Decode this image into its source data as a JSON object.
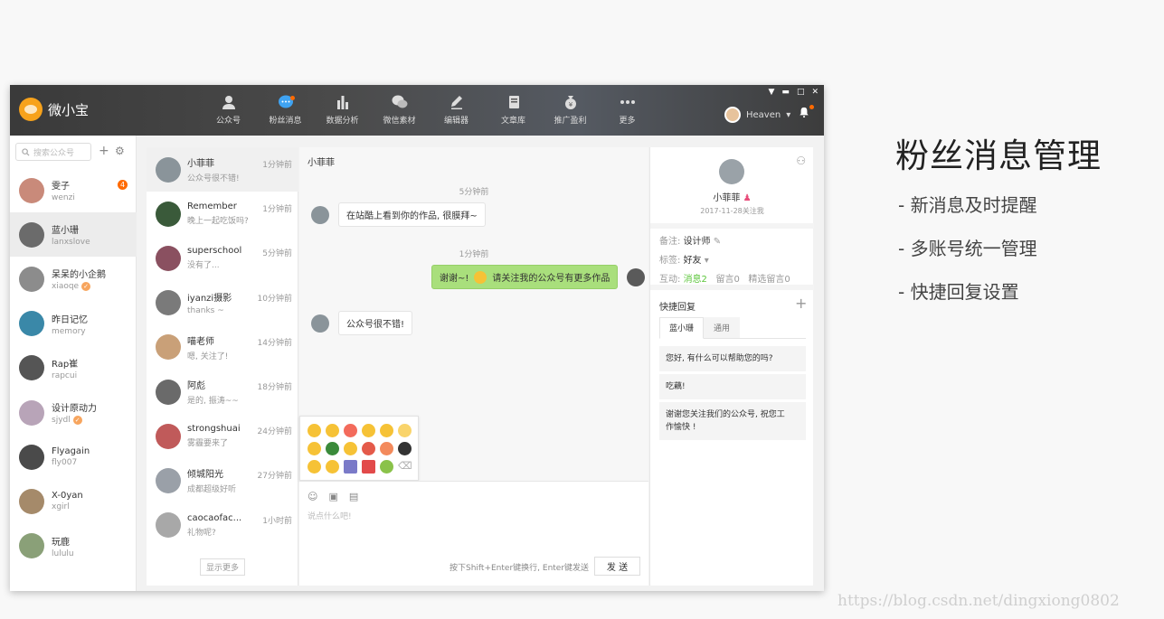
{
  "app": {
    "name": "微小宝"
  },
  "nav": [
    {
      "label": "公众号",
      "icon": "user-icon"
    },
    {
      "label": "粉丝消息",
      "icon": "chat-bubble-icon",
      "dot": true
    },
    {
      "label": "数据分析",
      "icon": "bar-chart-icon"
    },
    {
      "label": "微信素材",
      "icon": "wechat-icon"
    },
    {
      "label": "编辑器",
      "icon": "pen-icon"
    },
    {
      "label": "文章库",
      "icon": "document-icon"
    },
    {
      "label": "推广盈利",
      "icon": "money-bag-icon"
    },
    {
      "label": "更多",
      "icon": "more-dots-icon"
    }
  ],
  "user": {
    "name": "Heaven"
  },
  "sidebar": {
    "search_placeholder": "搜索公众号",
    "accounts": [
      {
        "name": "雯子",
        "sub": "wenzi",
        "count": "4",
        "color": "#c98a7a"
      },
      {
        "name": "蓝小珊",
        "sub": "lanxslove",
        "color": "#6b6b6b"
      },
      {
        "name": "呆呆的小企鹅",
        "sub": "xiaoqe",
        "verified": true,
        "color": "#8c8c8c"
      },
      {
        "name": "昨日记忆",
        "sub": "memory",
        "color": "#3a88a8"
      },
      {
        "name": "Rap崔",
        "sub": "rapcui",
        "color": "#555555"
      },
      {
        "name": "设计原动力",
        "sub": "sjydl",
        "verified": true,
        "color": "#b8a4b8"
      },
      {
        "name": "Flyagain",
        "sub": "fly007",
        "color": "#4a4a4a"
      },
      {
        "name": "X-0yan",
        "sub": "xgirl",
        "color": "#a58a6a"
      },
      {
        "name": "玩鹿",
        "sub": "lululu",
        "color": "#8aa078"
      }
    ]
  },
  "conversations": [
    {
      "name": "小菲菲",
      "preview": "公众号很不错!",
      "time": "1分钟前",
      "color": "#8a949a"
    },
    {
      "name": "Remember",
      "preview": "晚上一起吃饭吗?",
      "time": "1分钟前",
      "color": "#3a5a3a"
    },
    {
      "name": "superschool",
      "preview": "没有了...",
      "time": "5分钟前",
      "color": "#8a5060"
    },
    {
      "name": "iyanzi摄影",
      "preview": "thanks ~",
      "time": "10分钟前",
      "color": "#7a7a7a"
    },
    {
      "name": "喵老师",
      "preview": "嗯, 关注了!",
      "time": "14分钟前",
      "color": "#c9a078"
    },
    {
      "name": "阿彪",
      "preview": "是的, 振涛~~",
      "time": "18分钟前",
      "color": "#6a6a6a"
    },
    {
      "name": "strongshuai",
      "preview": "雾霾要来了",
      "time": "24分钟前",
      "color": "#c05a5a"
    },
    {
      "name": "倾城阳光",
      "preview": "成都超级好听",
      "time": "27分钟前",
      "color": "#9aa0a8"
    },
    {
      "name": "caocaofac...",
      "preview": "礼物呢?",
      "time": "1小时前",
      "color": "#a8a8a8"
    }
  ],
  "conv_more": "显示更多",
  "chat": {
    "title": "小菲菲",
    "time1": "5分钟前",
    "msg1": "在站酷上看到你的作品, 很膜拜~",
    "time2": "1分钟前",
    "msg2a": "谢谢~!",
    "msg2b": "请关注我的公众号有更多作品",
    "msg3": "公众号很不错!",
    "input_placeholder": "说点什么吧!",
    "hint": "按下Shift+Enter键换行, Enter键发送",
    "send": "发 送"
  },
  "profile": {
    "name": "小菲菲",
    "follow": "2017-11-28关注我",
    "remark_label": "备注:",
    "remark_value": "设计师",
    "tag_label": "标签:",
    "tag_value": "好友",
    "interact_label": "互动:",
    "messages": "消息2",
    "comments": "留言0",
    "featured": "精选留言0"
  },
  "quick_reply": {
    "title": "快捷回复",
    "tabs": [
      "蓝小珊",
      "通用"
    ],
    "items": [
      "您好, 有什么可以帮助您的吗?",
      "吃藕!",
      "谢谢您关注我们的公众号, 祝您工作愉快 !"
    ]
  },
  "features": {
    "title": "粉丝消息管理",
    "items": [
      "- 新消息及时提醒",
      "- 多账号统一管理",
      "- 快捷回复设置"
    ]
  },
  "watermark": "https://blog.csdn.net/dingxiong0802"
}
